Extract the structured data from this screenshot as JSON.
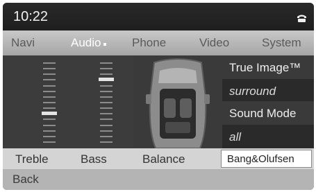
{
  "status_bar": {
    "time": "10:22",
    "icon": "phone-handset-icon"
  },
  "menu": {
    "items": [
      {
        "label": "Navi",
        "active": false
      },
      {
        "label": "Audio",
        "active": true
      },
      {
        "label": "Phone",
        "active": false
      },
      {
        "label": "Video",
        "active": false
      },
      {
        "label": "System",
        "active": false
      }
    ]
  },
  "sound_panel": {
    "true_image_label": "True Image™",
    "true_image_value": "surround",
    "sound_mode_label": "Sound Mode",
    "sound_mode_value": "all"
  },
  "equalizer": {
    "treble_level": 0.36,
    "bass_level": 0.79
  },
  "tabs": {
    "treble": "Treble",
    "bass": "Bass",
    "balance": "Balance",
    "bang_olufsen": "Bang&Olufsen"
  },
  "bottom": {
    "back": "Back"
  },
  "colors": {
    "active_text": "#ffffff",
    "inactive_text": "#5a5a5a",
    "highlight": "#ffffff"
  }
}
